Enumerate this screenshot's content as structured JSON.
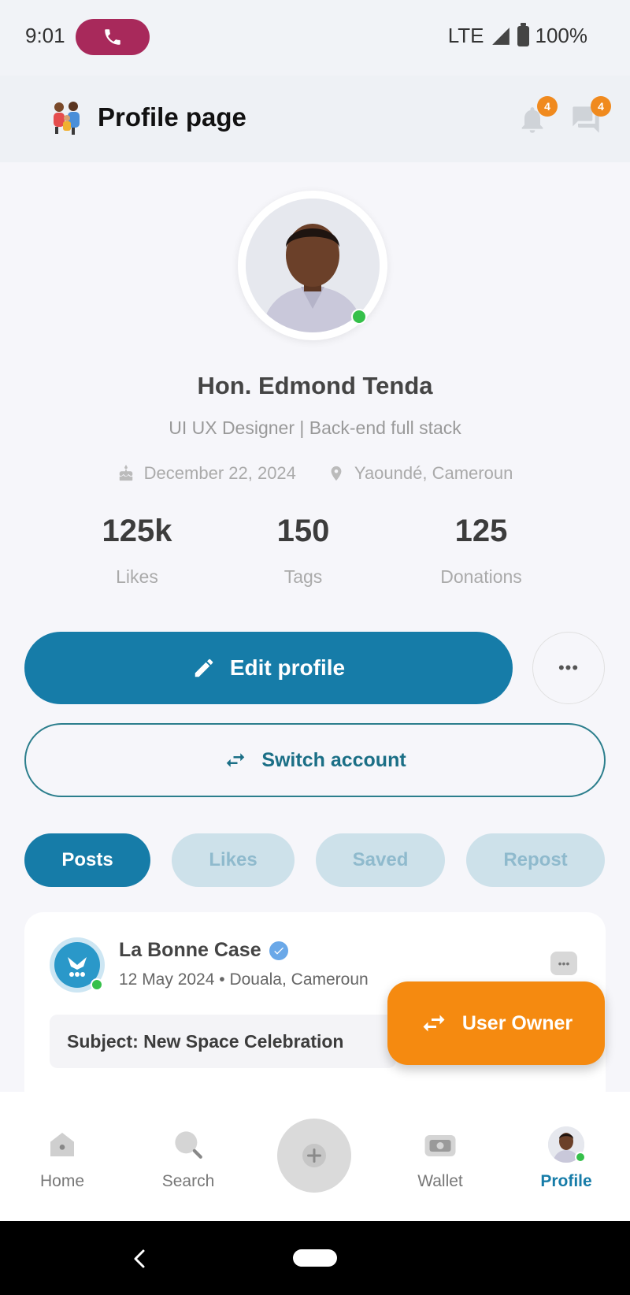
{
  "status_bar": {
    "time": "9:01",
    "network": "LTE",
    "battery": "100%"
  },
  "header": {
    "title": "Profile page",
    "notifications_count": "4",
    "messages_count": "4"
  },
  "profile": {
    "name": "Hon. Edmond Tenda",
    "bio": "UI UX Designer | Back-end full stack",
    "birthday": "December 22, 2024",
    "location": "Yaoundé, Cameroun",
    "online": true
  },
  "stats": [
    {
      "value": "125k",
      "label": "Likes"
    },
    {
      "value": "150",
      "label": "Tags"
    },
    {
      "value": "125",
      "label": "Donations"
    }
  ],
  "actions": {
    "edit_label": "Edit profile",
    "more_label": "•••",
    "switch_label": "Switch account"
  },
  "tabs": [
    {
      "label": "Posts",
      "active": true
    },
    {
      "label": "Likes",
      "active": false
    },
    {
      "label": "Saved",
      "active": false
    },
    {
      "label": "Repost",
      "active": false
    }
  ],
  "post": {
    "author": "La Bonne Case",
    "verified": true,
    "date": "12 May 2024",
    "location": "Douala, Cameroun",
    "meta": "12 May 2024 • Douala, Cameroun",
    "subject": "Subject: New Space Celebration",
    "more_label": "•••"
  },
  "fab": {
    "label": "User Owner"
  },
  "bottom_nav": [
    {
      "label": "Home",
      "icon": "home-icon",
      "active": false
    },
    {
      "label": "Search",
      "icon": "search-icon",
      "active": false
    },
    {
      "label": "",
      "icon": "add-icon",
      "active": false
    },
    {
      "label": "Wallet",
      "icon": "wallet-icon",
      "active": false
    },
    {
      "label": "Profile",
      "icon": "profile-avatar",
      "active": true
    }
  ],
  "colors": {
    "primary": "#167ca8",
    "accent": "#f58a10",
    "online": "#35c04a",
    "call": "#a8295b",
    "tab_inactive": "#cde1ea"
  }
}
